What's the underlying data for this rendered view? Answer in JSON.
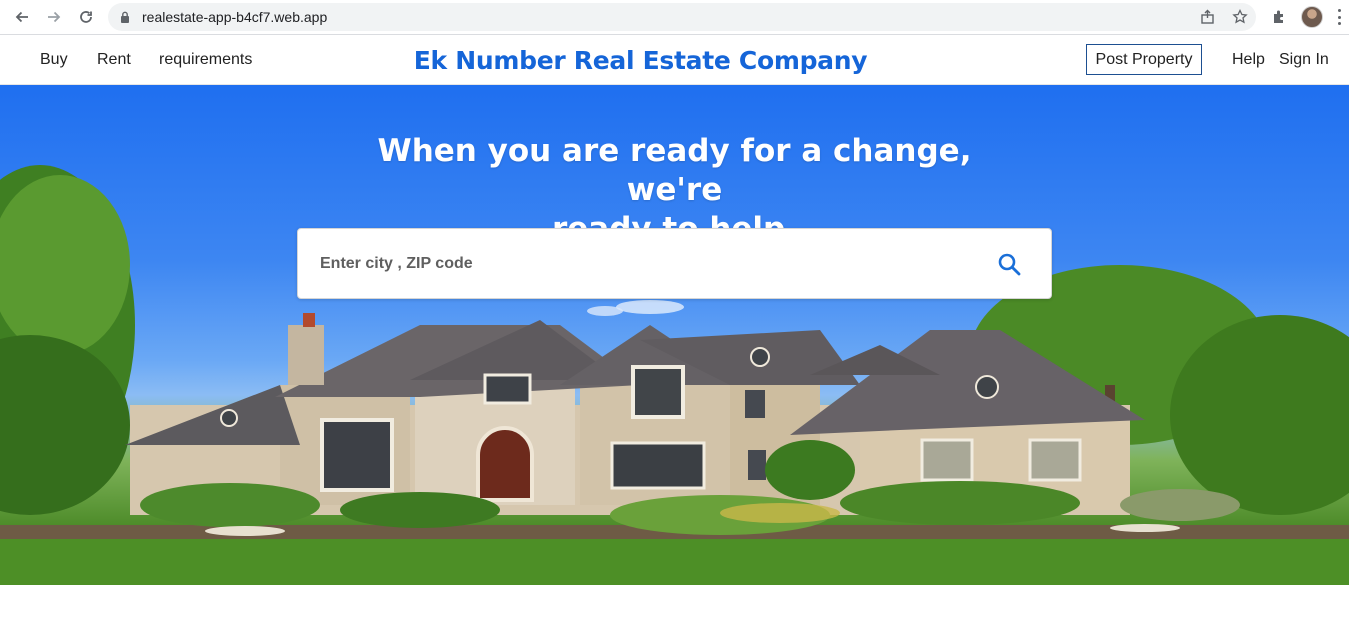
{
  "browser": {
    "url": "realestate-app-b4cf7.web.app"
  },
  "nav": {
    "left_links": [
      {
        "label": "Buy"
      },
      {
        "label": "Rent"
      },
      {
        "label": "requirements"
      }
    ],
    "brand": "Ek Number Real Estate Company",
    "post_property": "Post Property",
    "help": "Help",
    "sign_in": "Sign In"
  },
  "hero": {
    "headline_line1": "When you are ready for a change, we're",
    "headline_line2": "ready to help.",
    "search_placeholder": "Enter city , ZIP code"
  },
  "colors": {
    "brand_blue": "#1565d8",
    "search_icon_blue": "#1a6fd8",
    "sky_blue": "#1f6ff0"
  }
}
